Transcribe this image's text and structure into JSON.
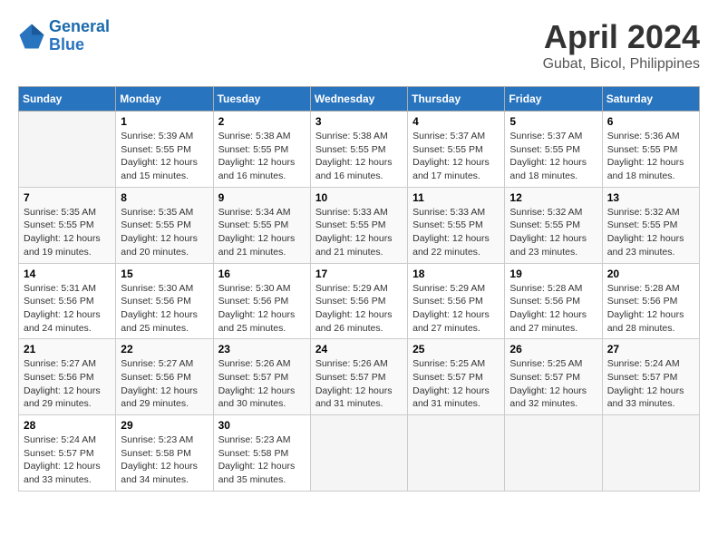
{
  "header": {
    "logo_line1": "General",
    "logo_line2": "Blue",
    "title": "April 2024",
    "subtitle": "Gubat, Bicol, Philippines"
  },
  "weekdays": [
    "Sunday",
    "Monday",
    "Tuesday",
    "Wednesday",
    "Thursday",
    "Friday",
    "Saturday"
  ],
  "weeks": [
    [
      {
        "day": "",
        "info": ""
      },
      {
        "day": "1",
        "info": "Sunrise: 5:39 AM\nSunset: 5:55 PM\nDaylight: 12 hours\nand 15 minutes."
      },
      {
        "day": "2",
        "info": "Sunrise: 5:38 AM\nSunset: 5:55 PM\nDaylight: 12 hours\nand 16 minutes."
      },
      {
        "day": "3",
        "info": "Sunrise: 5:38 AM\nSunset: 5:55 PM\nDaylight: 12 hours\nand 16 minutes."
      },
      {
        "day": "4",
        "info": "Sunrise: 5:37 AM\nSunset: 5:55 PM\nDaylight: 12 hours\nand 17 minutes."
      },
      {
        "day": "5",
        "info": "Sunrise: 5:37 AM\nSunset: 5:55 PM\nDaylight: 12 hours\nand 18 minutes."
      },
      {
        "day": "6",
        "info": "Sunrise: 5:36 AM\nSunset: 5:55 PM\nDaylight: 12 hours\nand 18 minutes."
      }
    ],
    [
      {
        "day": "7",
        "info": "Sunrise: 5:35 AM\nSunset: 5:55 PM\nDaylight: 12 hours\nand 19 minutes."
      },
      {
        "day": "8",
        "info": "Sunrise: 5:35 AM\nSunset: 5:55 PM\nDaylight: 12 hours\nand 20 minutes."
      },
      {
        "day": "9",
        "info": "Sunrise: 5:34 AM\nSunset: 5:55 PM\nDaylight: 12 hours\nand 21 minutes."
      },
      {
        "day": "10",
        "info": "Sunrise: 5:33 AM\nSunset: 5:55 PM\nDaylight: 12 hours\nand 21 minutes."
      },
      {
        "day": "11",
        "info": "Sunrise: 5:33 AM\nSunset: 5:55 PM\nDaylight: 12 hours\nand 22 minutes."
      },
      {
        "day": "12",
        "info": "Sunrise: 5:32 AM\nSunset: 5:55 PM\nDaylight: 12 hours\nand 23 minutes."
      },
      {
        "day": "13",
        "info": "Sunrise: 5:32 AM\nSunset: 5:55 PM\nDaylight: 12 hours\nand 23 minutes."
      }
    ],
    [
      {
        "day": "14",
        "info": "Sunrise: 5:31 AM\nSunset: 5:56 PM\nDaylight: 12 hours\nand 24 minutes."
      },
      {
        "day": "15",
        "info": "Sunrise: 5:30 AM\nSunset: 5:56 PM\nDaylight: 12 hours\nand 25 minutes."
      },
      {
        "day": "16",
        "info": "Sunrise: 5:30 AM\nSunset: 5:56 PM\nDaylight: 12 hours\nand 25 minutes."
      },
      {
        "day": "17",
        "info": "Sunrise: 5:29 AM\nSunset: 5:56 PM\nDaylight: 12 hours\nand 26 minutes."
      },
      {
        "day": "18",
        "info": "Sunrise: 5:29 AM\nSunset: 5:56 PM\nDaylight: 12 hours\nand 27 minutes."
      },
      {
        "day": "19",
        "info": "Sunrise: 5:28 AM\nSunset: 5:56 PM\nDaylight: 12 hours\nand 27 minutes."
      },
      {
        "day": "20",
        "info": "Sunrise: 5:28 AM\nSunset: 5:56 PM\nDaylight: 12 hours\nand 28 minutes."
      }
    ],
    [
      {
        "day": "21",
        "info": "Sunrise: 5:27 AM\nSunset: 5:56 PM\nDaylight: 12 hours\nand 29 minutes."
      },
      {
        "day": "22",
        "info": "Sunrise: 5:27 AM\nSunset: 5:56 PM\nDaylight: 12 hours\nand 29 minutes."
      },
      {
        "day": "23",
        "info": "Sunrise: 5:26 AM\nSunset: 5:57 PM\nDaylight: 12 hours\nand 30 minutes."
      },
      {
        "day": "24",
        "info": "Sunrise: 5:26 AM\nSunset: 5:57 PM\nDaylight: 12 hours\nand 31 minutes."
      },
      {
        "day": "25",
        "info": "Sunrise: 5:25 AM\nSunset: 5:57 PM\nDaylight: 12 hours\nand 31 minutes."
      },
      {
        "day": "26",
        "info": "Sunrise: 5:25 AM\nSunset: 5:57 PM\nDaylight: 12 hours\nand 32 minutes."
      },
      {
        "day": "27",
        "info": "Sunrise: 5:24 AM\nSunset: 5:57 PM\nDaylight: 12 hours\nand 33 minutes."
      }
    ],
    [
      {
        "day": "28",
        "info": "Sunrise: 5:24 AM\nSunset: 5:57 PM\nDaylight: 12 hours\nand 33 minutes."
      },
      {
        "day": "29",
        "info": "Sunrise: 5:23 AM\nSunset: 5:58 PM\nDaylight: 12 hours\nand 34 minutes."
      },
      {
        "day": "30",
        "info": "Sunrise: 5:23 AM\nSunset: 5:58 PM\nDaylight: 12 hours\nand 35 minutes."
      },
      {
        "day": "",
        "info": ""
      },
      {
        "day": "",
        "info": ""
      },
      {
        "day": "",
        "info": ""
      },
      {
        "day": "",
        "info": ""
      }
    ]
  ]
}
